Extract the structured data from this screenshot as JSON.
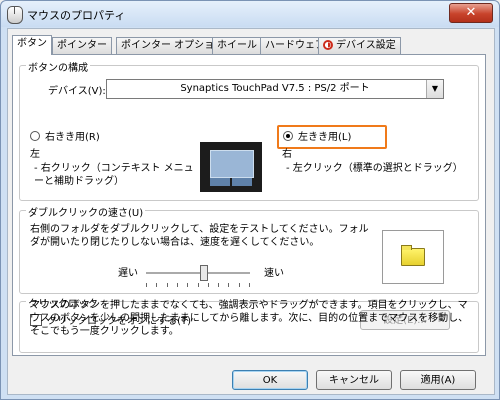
{
  "window": {
    "title": "マウスのプロパティ",
    "close_glyph": "✕"
  },
  "tabs": [
    {
      "label": "ボタン"
    },
    {
      "label": "ポインター"
    },
    {
      "label": "ポインター オプション"
    },
    {
      "label": "ホイール"
    },
    {
      "label": "ハードウェア"
    },
    {
      "label": "デバイス設定"
    }
  ],
  "button_config": {
    "group_label": "ボタンの構成",
    "device_label": "デバイス(V):",
    "device_value": "Synaptics TouchPad V7.5 : PS/2 ポート",
    "right_handed": {
      "label": "右きき用(R)",
      "selected": false
    },
    "left_handed": {
      "label": "左きき用(L)",
      "selected": true
    },
    "left_desc_title": "左",
    "left_desc_text": "- 右クリック（コンテキスト メニューと補助ドラッグ）",
    "right_desc_title": "右",
    "right_desc_text": "- 左クリック（標準の選択とドラッグ）"
  },
  "double_click": {
    "group_label": "ダブルクリックの速さ(U)",
    "instructions": "右側のフォルダをダブルクリックして、設定をテストしてください。フォルダが開いたり閉じたりしない場合は、速度を遅くしてください。",
    "slow_label": "遅い",
    "fast_label": "速い",
    "speed_level": 0.55
  },
  "click_lock": {
    "group_label": "クリックロック",
    "checkbox_label": "クリックロックをオンにする(T)",
    "checked": false,
    "settings_button": "設定(E)...",
    "description": "マウスのボタンを押したままでなくても、強調表示やドラッグができます。項目をクリックし、マウスのボタンを少しの間押したままにしてから離します。次に、目的の位置までマウスを移動し、そこでもう一度クリックします。"
  },
  "footer": {
    "ok_label": "OK",
    "cancel_label": "キャンセル",
    "apply_label": "適用(A)"
  }
}
